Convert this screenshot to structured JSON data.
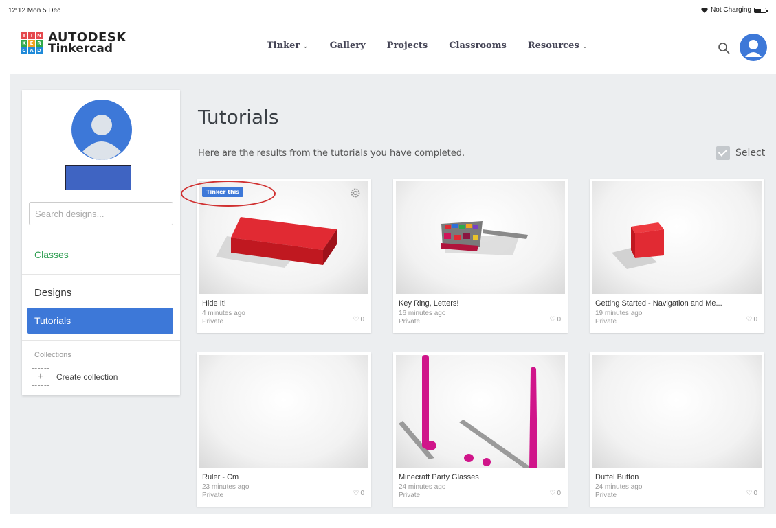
{
  "status_bar": {
    "time": "12:12  Mon 5 Dec",
    "battery_text": "Not Charging"
  },
  "brand": {
    "logo_letters": [
      "T",
      "I",
      "N",
      "K",
      "E",
      "R",
      "C",
      "A",
      "D"
    ],
    "line1": "AUTODESK",
    "line2": "Tinkercad"
  },
  "nav": [
    {
      "label": "Tinker",
      "dropdown": true
    },
    {
      "label": "Gallery",
      "dropdown": false
    },
    {
      "label": "Projects",
      "dropdown": false
    },
    {
      "label": "Classrooms",
      "dropdown": false
    },
    {
      "label": "Resources",
      "dropdown": true
    }
  ],
  "sidebar": {
    "search_placeholder": "Search designs...",
    "classes": "Classes",
    "designs": "Designs",
    "tutorials": "Tutorials",
    "collections_heading": "Collections",
    "create_collection": "Create collection"
  },
  "main": {
    "title": "Tutorials",
    "subtitle": "Here are the results from the tutorials you have completed.",
    "select_label": "Select"
  },
  "cards": [
    {
      "name": "Hide It!",
      "time": "4 minutes ago",
      "privacy": "Private",
      "likes": "0",
      "badge": "Tinker this"
    },
    {
      "name": "Key Ring, Letters!",
      "time": "16 minutes ago",
      "privacy": "Private",
      "likes": "0"
    },
    {
      "name": "Getting Started - Navigation and Me...",
      "time": "19 minutes ago",
      "privacy": "Private",
      "likes": "0"
    },
    {
      "name": "Ruler - Cm",
      "time": "23 minutes ago",
      "privacy": "Private",
      "likes": "0"
    },
    {
      "name": "Minecraft Party Glasses",
      "time": "24 minutes ago",
      "privacy": "Private",
      "likes": "0"
    },
    {
      "name": "Duffel Button",
      "time": "24 minutes ago",
      "privacy": "Private",
      "likes": "0"
    }
  ],
  "colors": {
    "accent": "#3d78d8",
    "classes_green": "#2e9e51",
    "annotation_red": "#d03030"
  }
}
